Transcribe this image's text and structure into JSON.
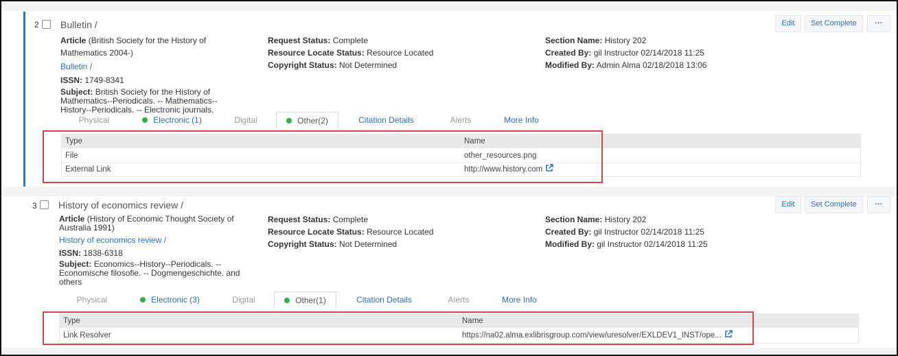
{
  "records": [
    {
      "number": "2",
      "title": "Bulletin /",
      "type_label": "Article",
      "type_value": "(British Society for the History of Mathematics 2004-)",
      "title_link": "Bulletin /",
      "issn_label": "ISSN:",
      "issn": "1749-8341",
      "subject_label": "Subject:",
      "subject": "British Society for the History of Mathematics--Periodicals. -- Mathematics--History--Periodicals. -- Electronic journals.",
      "request_status_label": "Request Status:",
      "request_status": "Complete",
      "locate_status_label": "Resource Locate Status:",
      "locate_status": "Resource Located",
      "copyright_label": "Copyright Status:",
      "copyright": "Not Determined",
      "section_label": "Section Name:",
      "section": "History 202",
      "created_label": "Created By:",
      "created": "gil Instructor 02/14/2018 11:25",
      "modified_label": "Modified By:",
      "modified": "Admin Alma 02/18/2018 13:06",
      "buttons": {
        "edit": "Edit",
        "complete": "Set Complete",
        "more": "···"
      },
      "tabs": [
        "Physical",
        "Electronic (1)",
        "Digital",
        "Other(2)",
        "Citation Details",
        "Alerts",
        "More Info"
      ],
      "table": {
        "headers": [
          "Type",
          "Name"
        ],
        "rows": [
          {
            "type": "File",
            "name": "other_resources.png"
          },
          {
            "type": "External Link",
            "name": "http://www.history.com"
          }
        ]
      }
    },
    {
      "number": "3",
      "title": "History of economics review /",
      "type_label": "Article",
      "type_value": "(History of Economic Thought Society of Australia 1991)",
      "title_link": "History of economics review /",
      "issn_label": "ISSN:",
      "issn": "1838-6318",
      "subject_label": "Subject:",
      "subject": "Economics--History--Periodicals. -- Economische filosofie. -- Dogmengeschichte. and others",
      "request_status_label": "Request Status:",
      "request_status": "Complete",
      "locate_status_label": "Resource Locate Status:",
      "locate_status": "Resource Located",
      "copyright_label": "Copyright Status:",
      "copyright": "Not Determined",
      "section_label": "Section Name:",
      "section": "History 202",
      "created_label": "Created By:",
      "created": "gil Instructor 02/14/2018 11:25",
      "modified_label": "Modified By:",
      "modified": "gil Instructor 02/14/2018 11:25",
      "buttons": {
        "edit": "Edit",
        "complete": "Set Complete",
        "more": "···"
      },
      "tabs": [
        "Physical",
        "Electronic (3)",
        "Digital",
        "Other(1)",
        "Citation Details",
        "Alerts",
        "More Info"
      ],
      "table": {
        "headers": [
          "Type",
          "Name"
        ],
        "rows": [
          {
            "type": "Link Resolver",
            "name": "https://na02.alma.exlibrisgroup.com/view/uresolver/EXLDEV1_INST/ope..."
          }
        ]
      }
    }
  ],
  "colors": {
    "link": "#2a6ebb",
    "highlight": "#d64545",
    "selected_border": "#2b7bc6",
    "available_dot": "#2fb344"
  },
  "icons": {
    "external_link": "external-link-icon",
    "checkbox": "checkbox-icon"
  }
}
